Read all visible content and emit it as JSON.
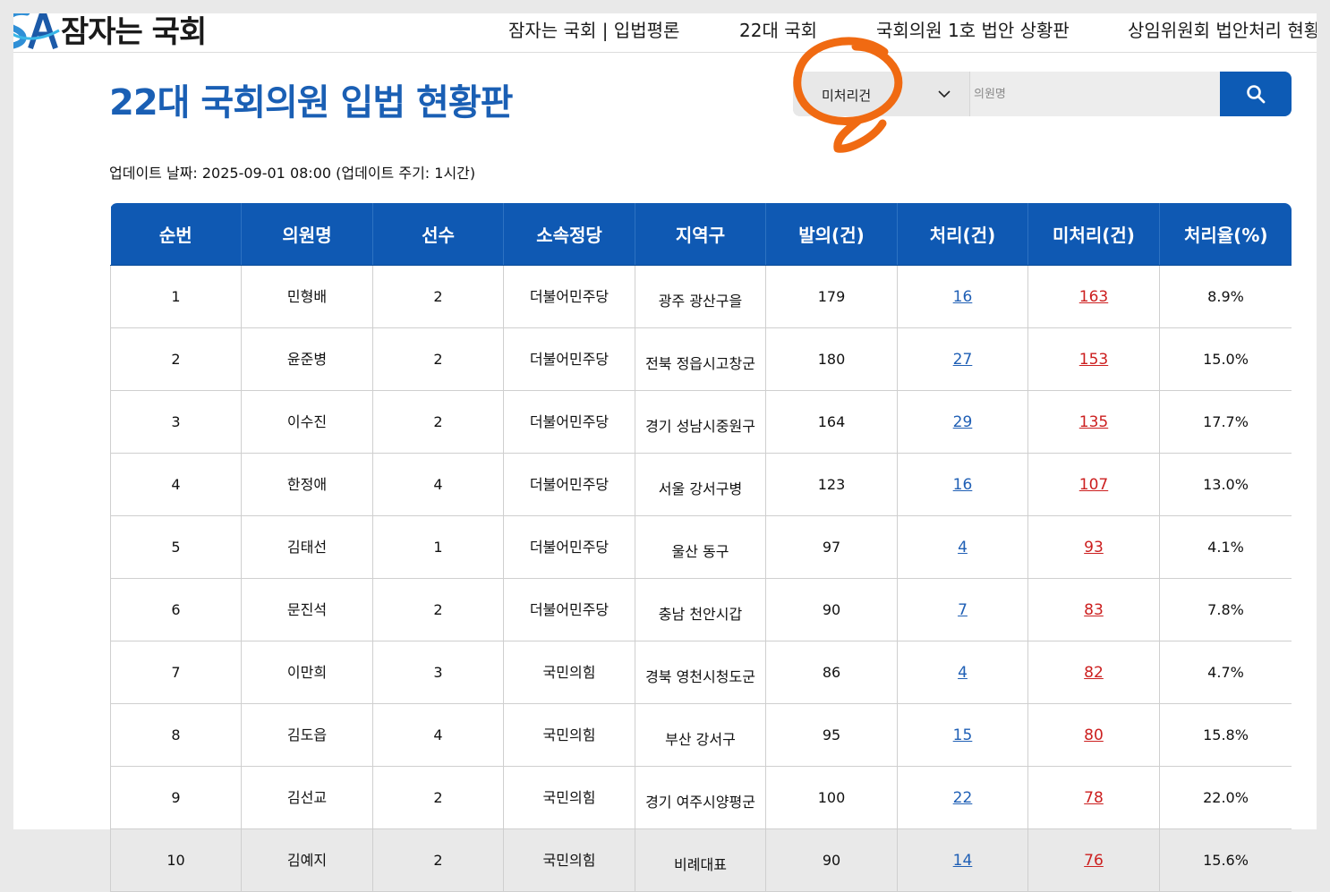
{
  "logo": {
    "text": "잠자는 국회"
  },
  "nav": [
    {
      "label": "잠자는 국회 | 입법평론"
    },
    {
      "label": "22대 국회"
    },
    {
      "label": "국회의원 1호 법안 상황판"
    },
    {
      "label": "상임위원회 법안처리 현황"
    }
  ],
  "title": "22대 국회의원 입법 현황판",
  "filter": {
    "selected": "미처리건"
  },
  "search": {
    "placeholder": "의원명",
    "value": ""
  },
  "update": {
    "text": "업데이트 날짜: 2025-09-01 08:00 (업데이트 주기: 1시간)"
  },
  "colors": {
    "brand": "#0f59b3",
    "processed_link": "#1f5fb5",
    "pending_link": "#cc1f1f",
    "annotation": "#f06a12"
  },
  "table": {
    "headers": [
      "순번",
      "의원명",
      "선수",
      "소속정당",
      "지역구",
      "발의(건)",
      "처리(건)",
      "미처리(건)",
      "처리율(%)"
    ],
    "rows": [
      {
        "rank": "1",
        "name": "민형배",
        "terms": "2",
        "party": "더불어민주당",
        "region": "광주 광산구을",
        "proposed": "179",
        "processed": "16",
        "pending": "163",
        "rate": "8.9%"
      },
      {
        "rank": "2",
        "name": "윤준병",
        "terms": "2",
        "party": "더불어민주당",
        "region": "전북 정읍시고창군",
        "proposed": "180",
        "processed": "27",
        "pending": "153",
        "rate": "15.0%"
      },
      {
        "rank": "3",
        "name": "이수진",
        "terms": "2",
        "party": "더불어민주당",
        "region": "경기 성남시중원구",
        "proposed": "164",
        "processed": "29",
        "pending": "135",
        "rate": "17.7%"
      },
      {
        "rank": "4",
        "name": "한정애",
        "terms": "4",
        "party": "더불어민주당",
        "region": "서울 강서구병",
        "proposed": "123",
        "processed": "16",
        "pending": "107",
        "rate": "13.0%"
      },
      {
        "rank": "5",
        "name": "김태선",
        "terms": "1",
        "party": "더불어민주당",
        "region": "울산 동구",
        "proposed": "97",
        "processed": "4",
        "pending": "93",
        "rate": "4.1%"
      },
      {
        "rank": "6",
        "name": "문진석",
        "terms": "2",
        "party": "더불어민주당",
        "region": "충남 천안시갑",
        "proposed": "90",
        "processed": "7",
        "pending": "83",
        "rate": "7.8%"
      },
      {
        "rank": "7",
        "name": "이만희",
        "terms": "3",
        "party": "국민의힘",
        "region": "경북 영천시청도군",
        "proposed": "86",
        "processed": "4",
        "pending": "82",
        "rate": "4.7%"
      },
      {
        "rank": "8",
        "name": "김도읍",
        "terms": "4",
        "party": "국민의힘",
        "region": "부산 강서구",
        "proposed": "95",
        "processed": "15",
        "pending": "80",
        "rate": "15.8%"
      },
      {
        "rank": "9",
        "name": "김선교",
        "terms": "2",
        "party": "국민의힘",
        "region": "경기 여주시양평군",
        "proposed": "100",
        "processed": "22",
        "pending": "78",
        "rate": "22.0%"
      },
      {
        "rank": "10",
        "name": "김예지",
        "terms": "2",
        "party": "국민의힘",
        "region": "비례대표",
        "proposed": "90",
        "processed": "14",
        "pending": "76",
        "rate": "15.6%"
      }
    ]
  }
}
